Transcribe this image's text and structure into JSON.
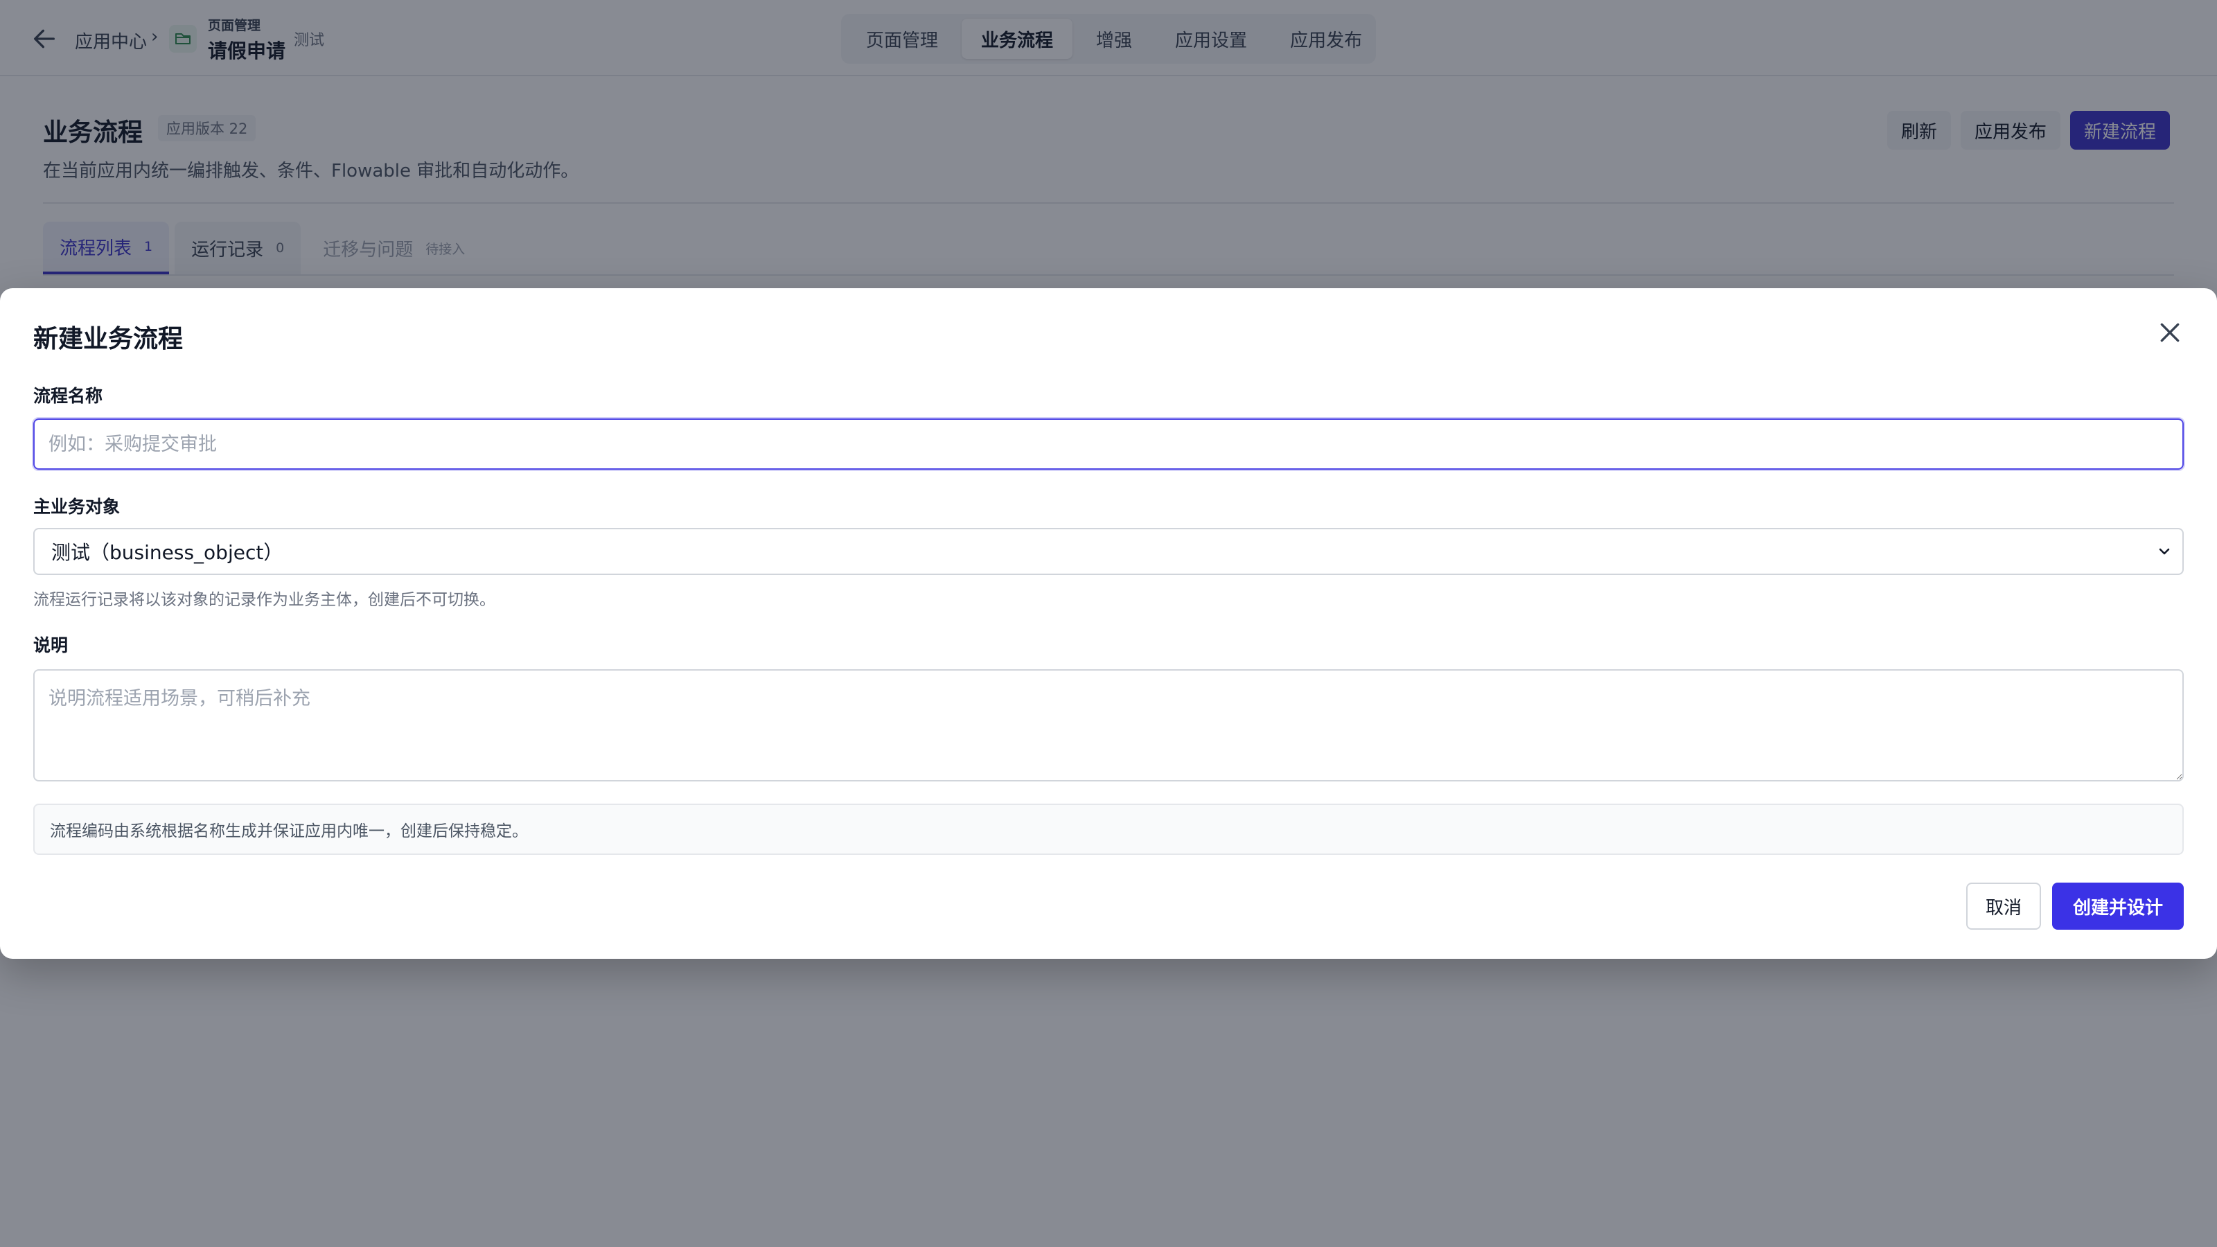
{
  "topbar": {
    "breadcrumb_root": "应用中心",
    "breadcrumb_sep": "›",
    "app_section": "页面管理",
    "app_name": "请假申请",
    "app_tag": "测试",
    "nav_tabs": [
      {
        "label": "页面管理",
        "active": false
      },
      {
        "label": "业务流程",
        "active": true
      },
      {
        "label": "增强",
        "active": false
      },
      {
        "label": "应用设置",
        "active": false
      },
      {
        "label": "应用发布",
        "active": false
      }
    ]
  },
  "page": {
    "title": "业务流程",
    "version_badge": "应用版本 22",
    "description": "在当前应用内统一编排触发、条件、Flowable 审批和自动化动作。",
    "buttons": {
      "refresh": "刷新",
      "publish": "应用发布",
      "new_flow": "新建流程"
    },
    "tabs": [
      {
        "label": "流程列表",
        "count": "1",
        "active": true
      },
      {
        "label": "运行记录",
        "count": "0",
        "active": false
      },
      {
        "label": "迁移与问题",
        "count": "待接入",
        "active": false
      }
    ]
  },
  "modal": {
    "title": "新建业务流程",
    "name_label": "流程名称",
    "name_placeholder": "例如：采购提交审批",
    "name_value": "",
    "object_label": "主业务对象",
    "object_selected": "测试（business_object）",
    "object_hint": "流程运行记录将以该对象的记录作为业务主体，创建后不可切换。",
    "desc_label": "说明",
    "desc_placeholder": "说明流程适用场景，可稍后补充",
    "info_text": "流程编码由系统根据名称生成并保证应用内唯一，创建后保持稳定。",
    "cancel_label": "取消",
    "create_label": "创建并设计"
  },
  "colors": {
    "primary": "#3b32e6",
    "primary_dark": "#3b32c9",
    "overlay": "rgba(17,24,39,0.5)",
    "app_icon": "#2f8a4f"
  }
}
